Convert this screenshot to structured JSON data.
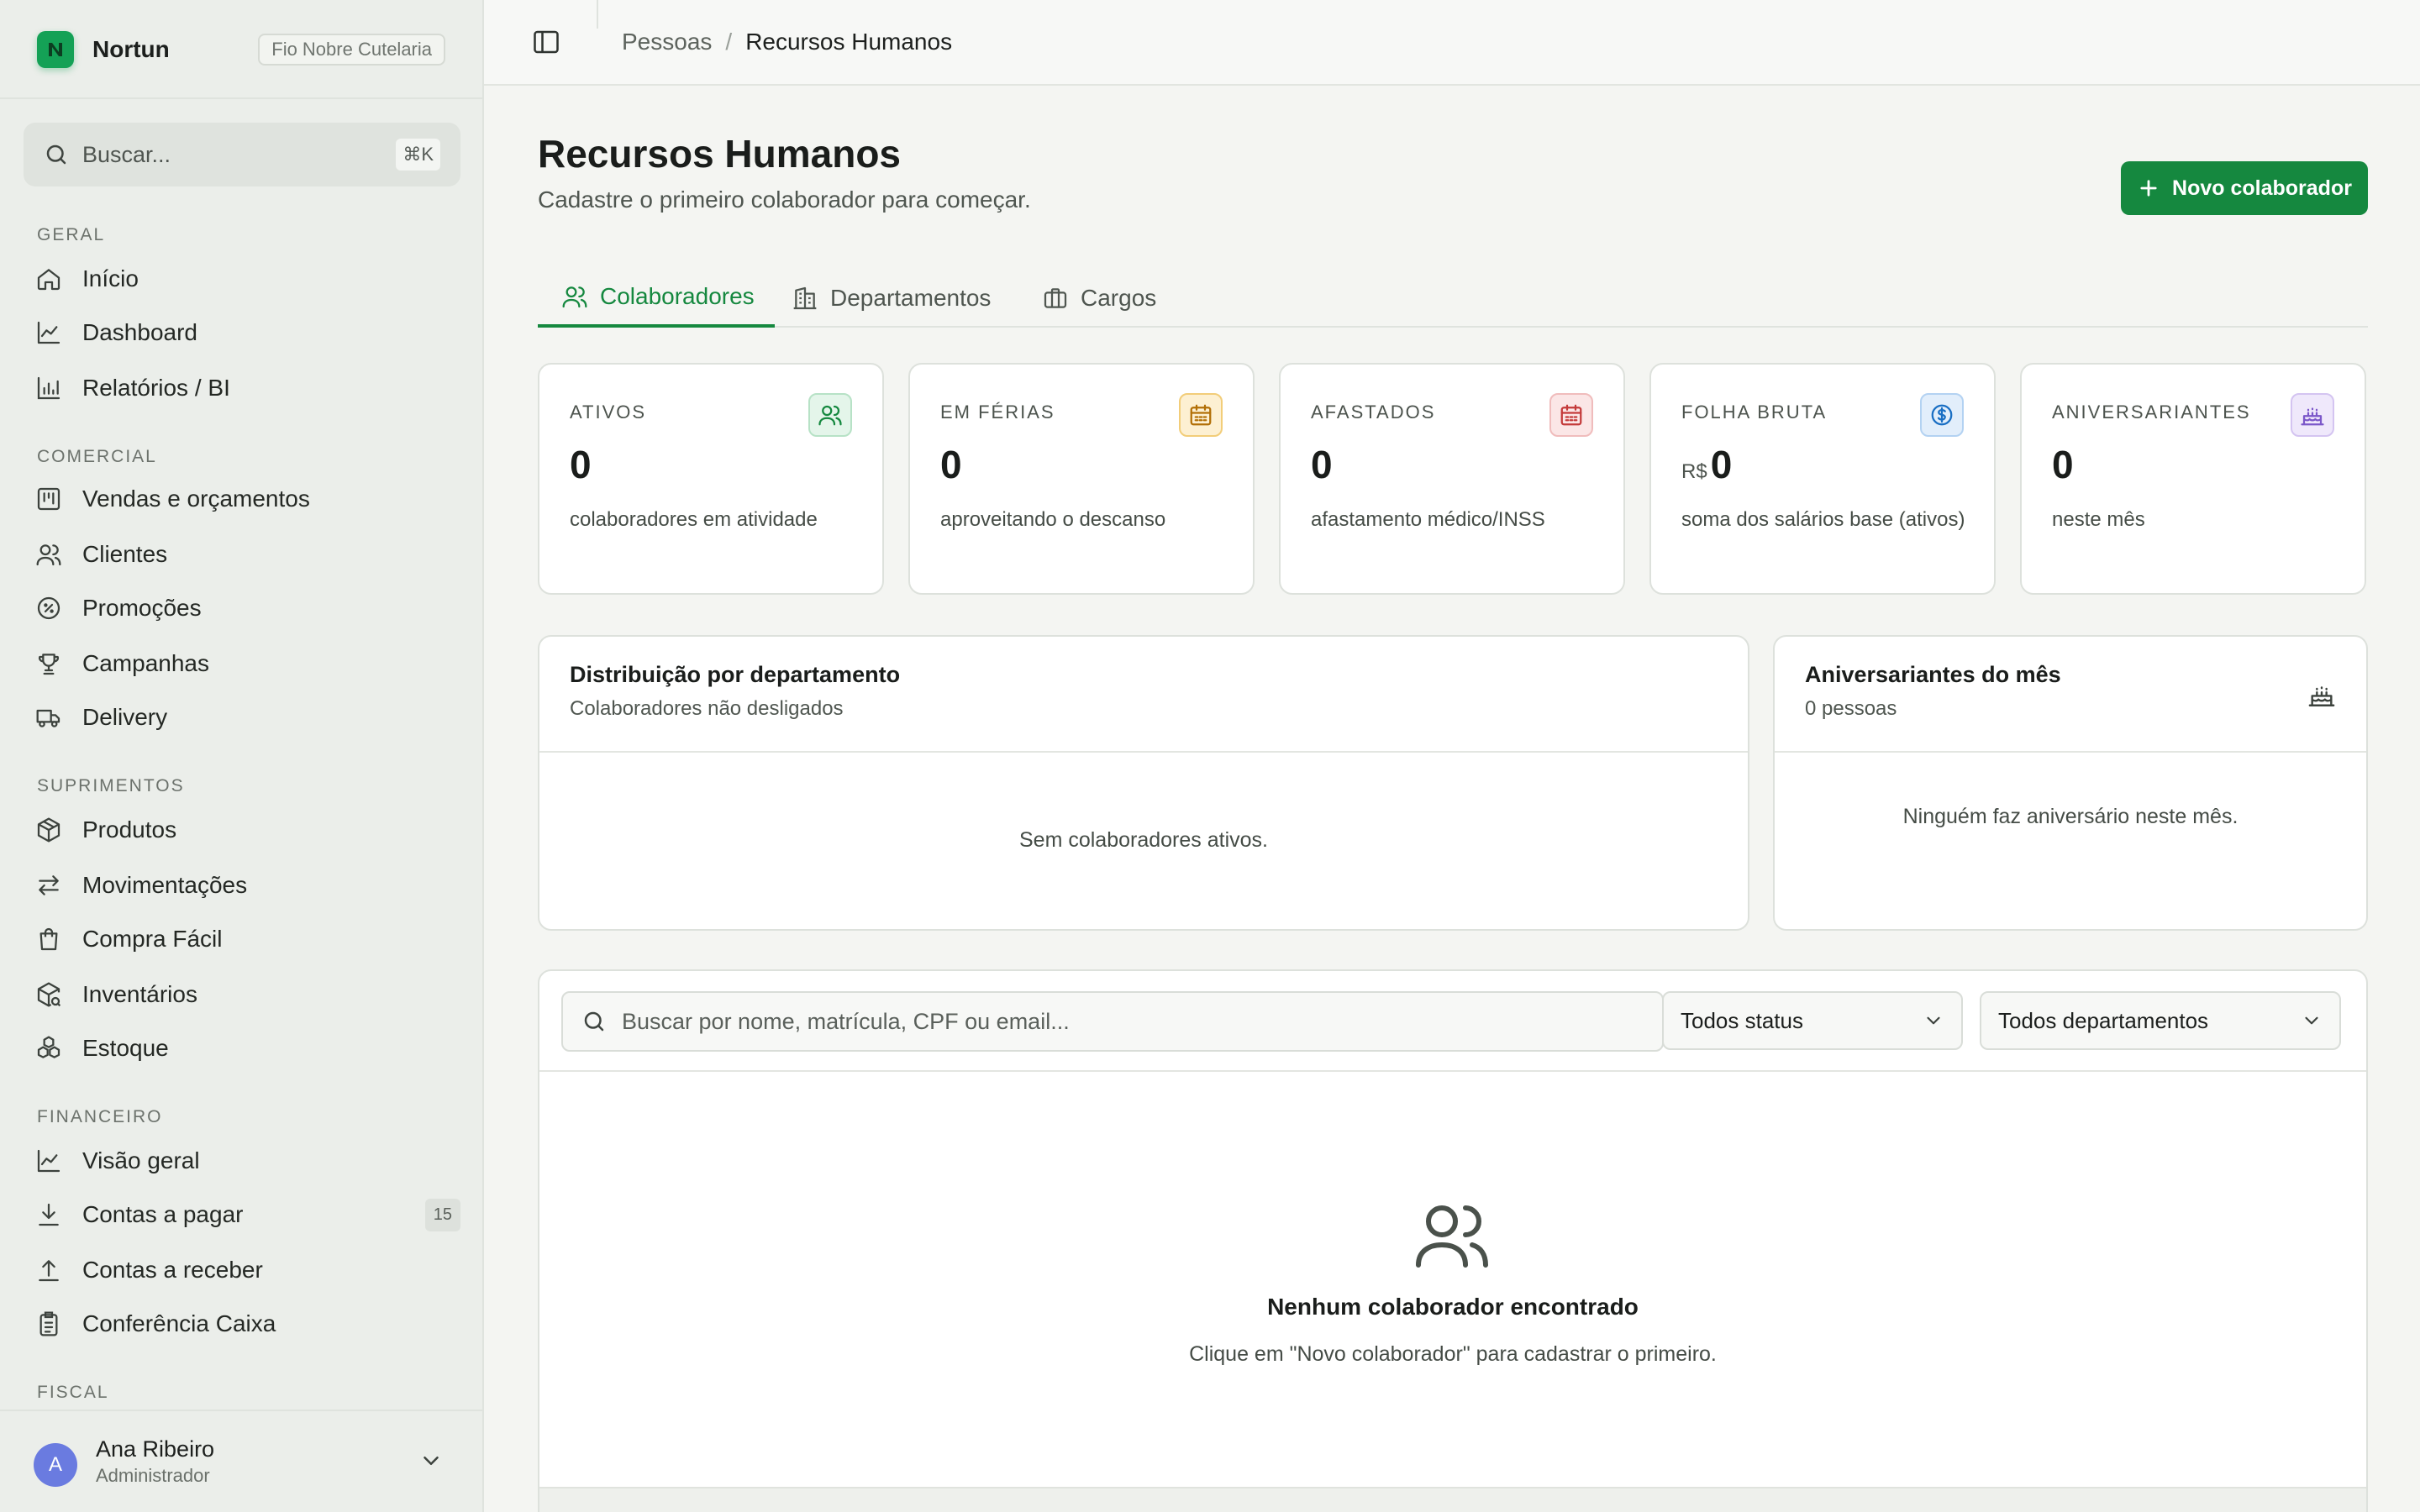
{
  "app": {
    "name": "Nortun",
    "tenant": "Fio Nobre Cutelaria"
  },
  "sidebar": {
    "search": {
      "placeholder": "Buscar...",
      "shortcut": "⌘K"
    },
    "sections": {
      "geral": "GERAL",
      "comercial": "COMERCIAL",
      "suprimentos": "SUPRIMENTOS",
      "financeiro": "FINANCEIRO",
      "fiscal": "FISCAL"
    },
    "items": {
      "inicio": "Início",
      "dashboard": "Dashboard",
      "relatorios": "Relatórios / BI",
      "vendas": "Vendas e orçamentos",
      "clientes": "Clientes",
      "promocoes": "Promoções",
      "campanhas": "Campanhas",
      "delivery": "Delivery",
      "produtos": "Produtos",
      "movimentacoes": "Movimentações",
      "compra_facil": "Compra Fácil",
      "inventarios": "Inventários",
      "estoque": "Estoque",
      "visao_geral": "Visão geral",
      "contas_pagar": "Contas a pagar",
      "contas_pagar_badge": "15",
      "contas_receber": "Contas a receber",
      "conferencia_caixa": "Conferência Caixa"
    },
    "user": {
      "initial": "A",
      "name": "Ana Ribeiro",
      "role": "Administrador"
    }
  },
  "topbar": {
    "breadcrumb": {
      "parent": "Pessoas",
      "separator": "/",
      "current": "Recursos Humanos"
    }
  },
  "page": {
    "title": "Recursos Humanos",
    "subtitle": "Cadastre o primeiro colaborador para começar.",
    "new_button": "Novo colaborador",
    "tabs": {
      "colaboradores": "Colaboradores",
      "departamentos": "Departamentos",
      "cargos": "Cargos"
    }
  },
  "kpis": {
    "ativos": {
      "label": "ATIVOS",
      "value": "0",
      "desc": "colaboradores em atividade",
      "color": "#15883f"
    },
    "ferias": {
      "label": "EM FÉRIAS",
      "value": "0",
      "desc": "aproveitando o descanso",
      "color": "#c27a0a"
    },
    "afastados": {
      "label": "AFASTADOS",
      "value": "0",
      "desc": "afastamento médico/INSS",
      "color": "#c43a3a"
    },
    "folha": {
      "label": "FOLHA BRUTA",
      "prefix": "R$",
      "value": "0",
      "desc": "soma dos salários base (ativos)",
      "color": "#1a6fc4"
    },
    "aniversariantes": {
      "label": "ANIVERSARIANTES",
      "value": "0",
      "desc": "neste mês",
      "color": "#7b57c9"
    }
  },
  "panels": {
    "distribuicao": {
      "title": "Distribuição por departamento",
      "subtitle": "Colaboradores não desligados",
      "empty": "Sem colaboradores ativos."
    },
    "aniversariantes": {
      "title": "Aniversariantes do mês",
      "subtitle": "0 pessoas",
      "empty": "Ninguém faz aniversário neste mês."
    }
  },
  "table": {
    "search_placeholder": "Buscar por nome, matrícula, CPF ou email...",
    "status_filter": "Todos status",
    "department_filter": "Todos departamentos",
    "empty_title": "Nenhum colaborador encontrado",
    "empty_sub": "Clique em \"Novo colaborador\" para cadastrar o primeiro."
  }
}
